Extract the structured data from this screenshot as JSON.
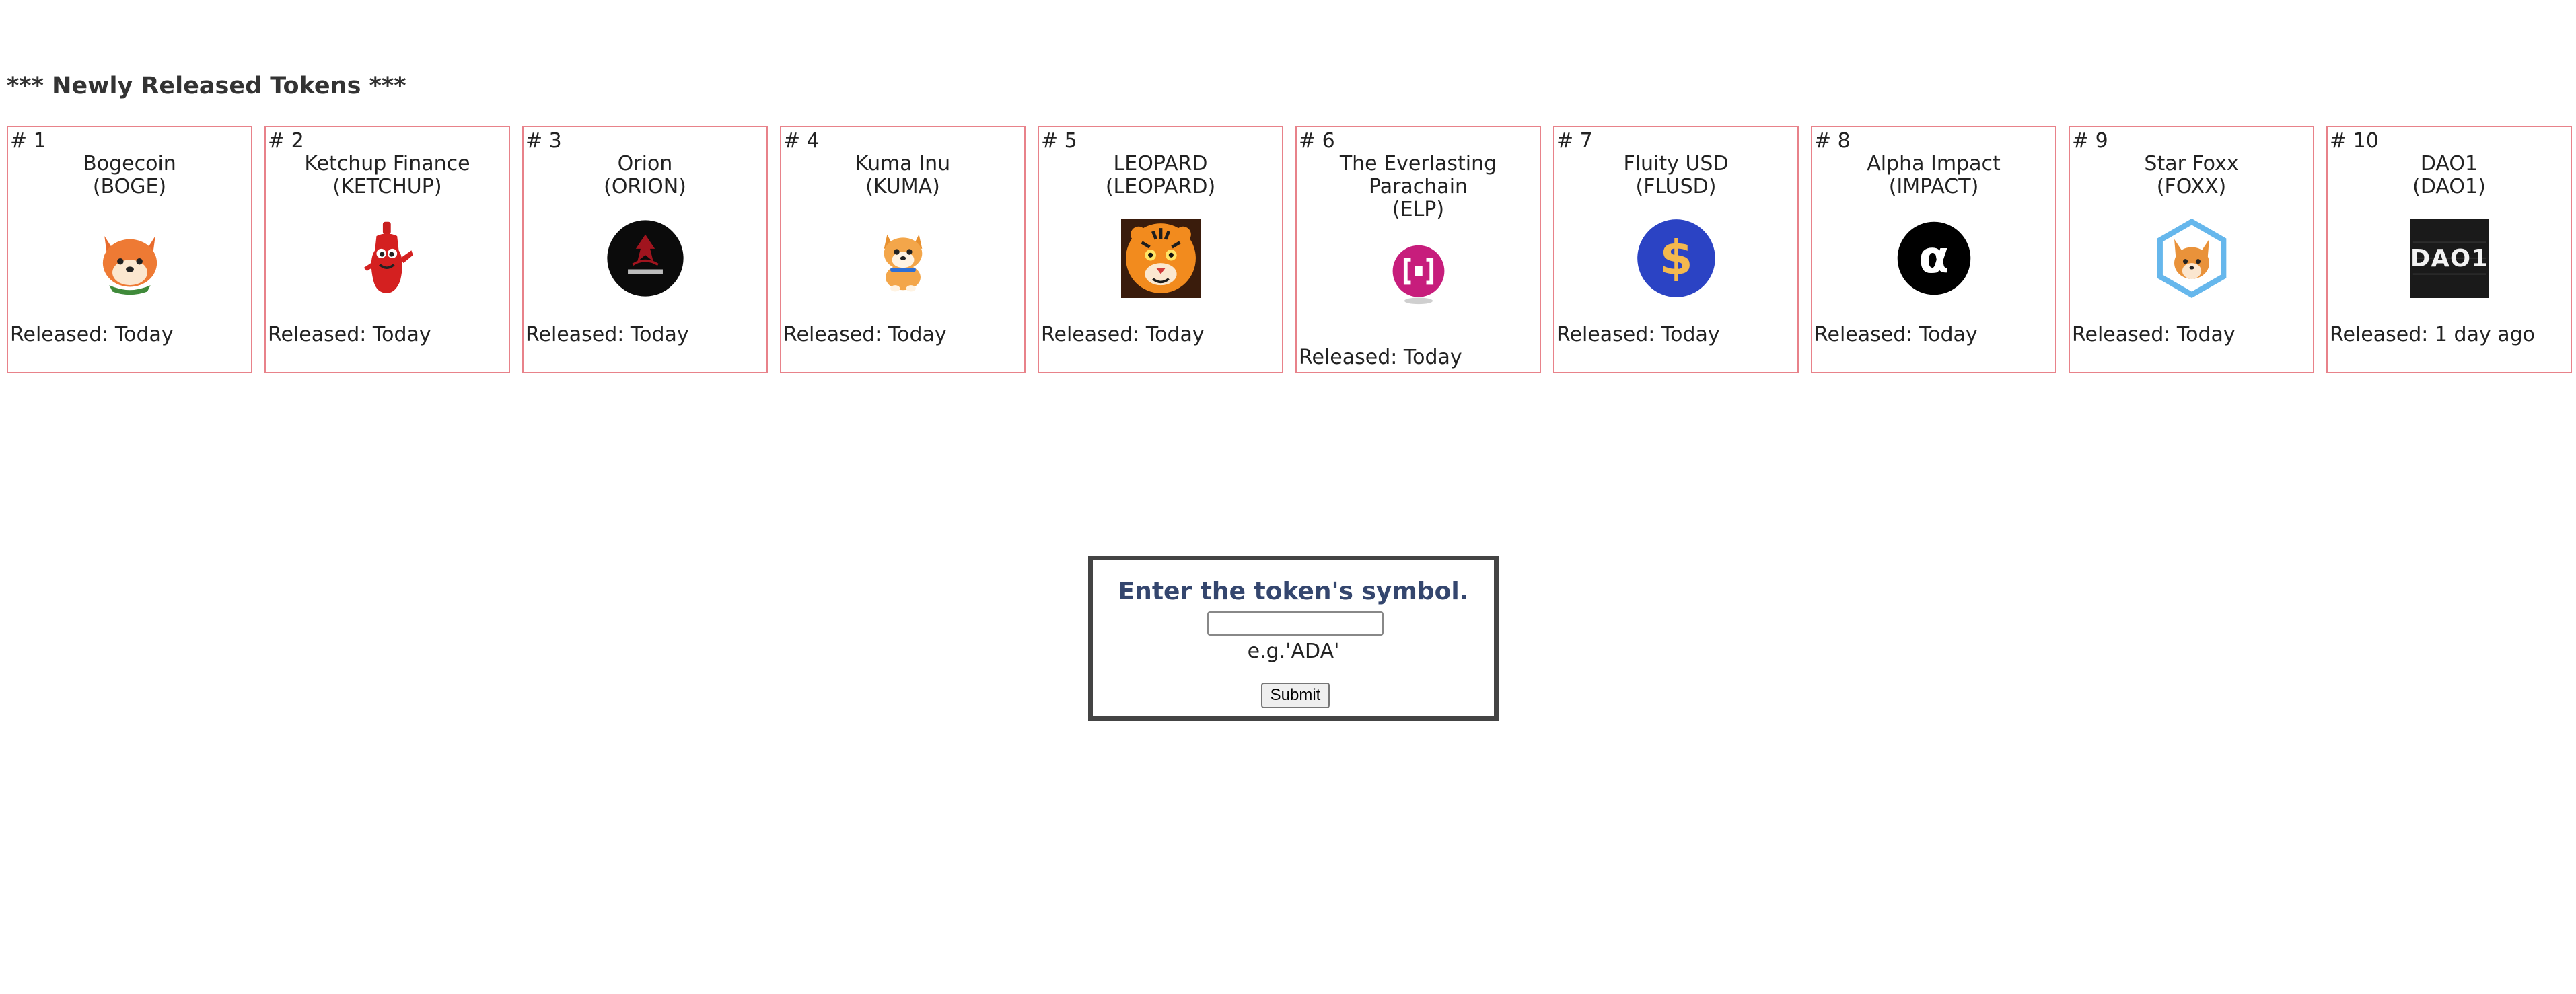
{
  "heading": "*** Newly Released Tokens ***",
  "tokens": [
    {
      "rank": "# 1",
      "name_lines": [
        "Bogecoin"
      ],
      "symbol": "(BOGE)",
      "released": "Released: Today",
      "logo_icon": "fox-mascot-icon"
    },
    {
      "rank": "# 2",
      "name_lines": [
        "Ketchup Finance"
      ],
      "symbol": "(KETCHUP)",
      "released": "Released: Today",
      "logo_icon": "ketchup-bottle-mascot-icon"
    },
    {
      "rank": "# 3",
      "name_lines": [
        "Orion"
      ],
      "symbol": "(ORION)",
      "released": "Released: Today",
      "logo_icon": "orion-logo-icon"
    },
    {
      "rank": "# 4",
      "name_lines": [
        "Kuma Inu"
      ],
      "symbol": "(KUMA)",
      "released": "Released: Today",
      "logo_icon": "shiba-dog-mascot-icon"
    },
    {
      "rank": "# 5",
      "name_lines": [
        "LEOPARD"
      ],
      "symbol": "(LEOPARD)",
      "released": "Released: Today",
      "logo_icon": "tiger-face-icon"
    },
    {
      "rank": "# 6",
      "name_lines": [
        "The Everlasting",
        "Parachain"
      ],
      "symbol": "(ELP)",
      "released": "Released: Today",
      "logo_icon": "elp-bracket-logo-icon"
    },
    {
      "rank": "# 7",
      "name_lines": [
        "Fluity USD"
      ],
      "symbol": "(FLUSD)",
      "released": "Released: Today",
      "logo_icon": "dollar-coin-icon"
    },
    {
      "rank": "# 8",
      "name_lines": [
        "Alpha Impact"
      ],
      "symbol": "(IMPACT)",
      "released": "Released: Today",
      "logo_icon": "alpha-symbol-icon"
    },
    {
      "rank": "# 9",
      "name_lines": [
        "Star Foxx"
      ],
      "symbol": "(FOXX)",
      "released": "Released: Today",
      "logo_icon": "fox-hexagon-icon"
    },
    {
      "rank": "# 10",
      "name_lines": [
        "DAO1"
      ],
      "symbol": "(DAO1)",
      "released": "Released: 1 day ago",
      "logo_icon": "dao1-logo-icon"
    }
  ],
  "form": {
    "prompt": "Enter the token's symbol.",
    "input_value": "",
    "example": "e.g.'ADA'",
    "submit_label": "Submit"
  },
  "colors": {
    "card_border": "#e8828a",
    "prompt_text": "#34466e",
    "form_border": "#444444"
  }
}
